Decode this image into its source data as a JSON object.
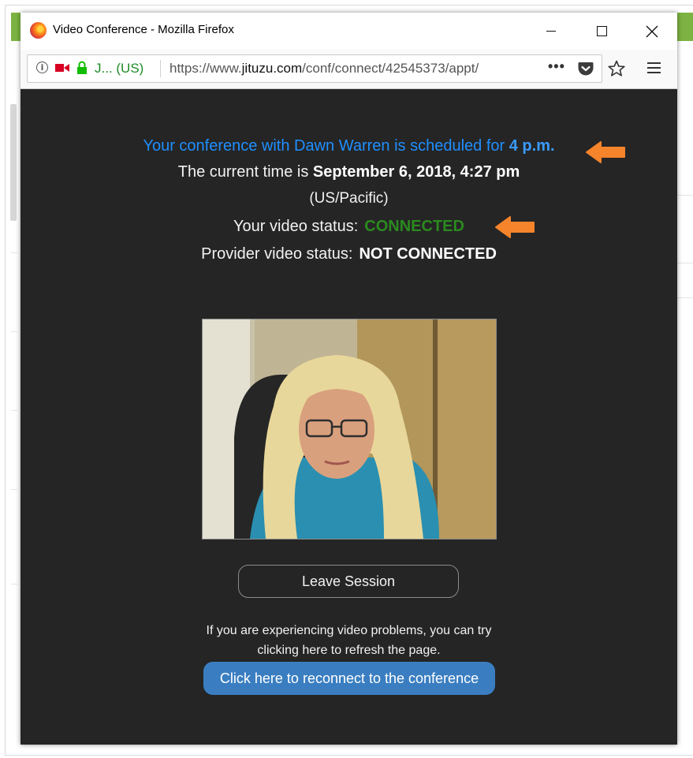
{
  "window": {
    "title": "Video Conference - Mozilla Firefox"
  },
  "navbar": {
    "site_identity": "J... (US)",
    "url_prefix": "https://www.",
    "url_domain": "jituzu.com",
    "url_path": "/conf/connect/42545373/appt/",
    "more_label": "•••"
  },
  "page": {
    "schedule_text": "Your conference with Dawn Warren is scheduled for",
    "schedule_time": "4 p.m.",
    "current_time_label": "The current time is",
    "current_time_value": "September 6, 2018, 4:27 pm",
    "timezone": "(US/Pacific)",
    "video_status_label": "Your video status:",
    "video_status_value": "CONNECTED",
    "provider_status_label": "Provider video status:",
    "provider_status_value": "NOT CONNECTED",
    "leave_button": "Leave Session",
    "help_line1": "If you are experiencing video problems, you can try",
    "help_line2": "clicking here to refresh the page.",
    "reconnect_button": "Click here to reconnect to the conference"
  },
  "colors": {
    "schedule_blue": "#1f8fff",
    "connected_green": "#2b8a1f",
    "reconnect_button": "#3a7ec1",
    "annotation_arrow": "#f5842b",
    "content_bg": "#252525"
  },
  "icons": [
    "firefox-logo-icon",
    "info-icon",
    "camera-icon",
    "lock-icon",
    "more-icon",
    "pocket-icon",
    "star-icon",
    "menu-icon",
    "arrow-icon"
  ]
}
